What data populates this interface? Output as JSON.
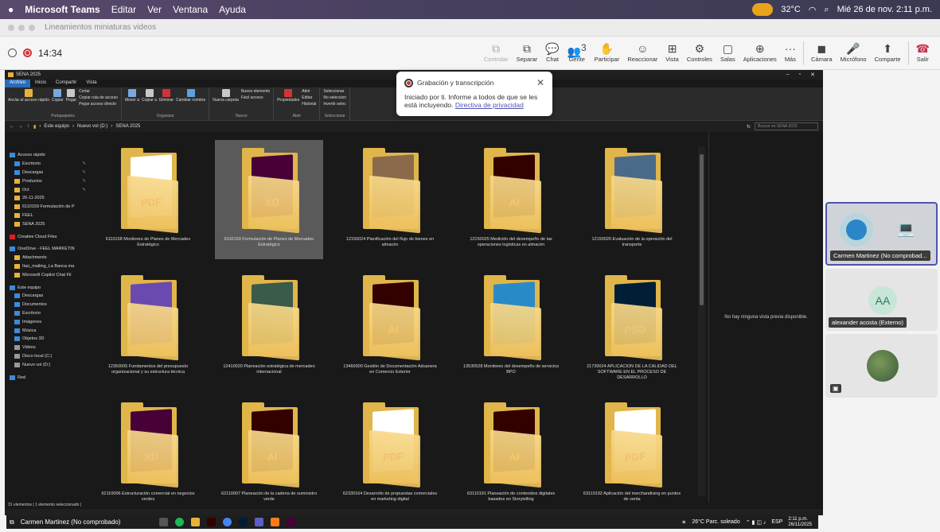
{
  "menubar": {
    "app": "Microsoft Teams",
    "menus": [
      "Editar",
      "Ver",
      "Ventana",
      "Ayuda"
    ],
    "weather": "32°C",
    "datetime": "Mié 26 de nov.  2:11 p.m."
  },
  "window": {
    "title": "Lineamientos miniaturas videos"
  },
  "meeting": {
    "timer": "14:34",
    "buttons": [
      {
        "label": "Controlar",
        "icon": "control-icon",
        "glyph": "⧉",
        "disabled": true
      },
      {
        "label": "Separar",
        "icon": "popout-icon",
        "glyph": "⧉"
      },
      {
        "label": "Chat",
        "icon": "chat-icon",
        "glyph": "💬"
      },
      {
        "label": "Gente",
        "icon": "people-icon",
        "glyph": "👥",
        "count": "3"
      },
      {
        "label": "Participar",
        "icon": "raise-hand-icon",
        "glyph": "✋"
      },
      {
        "label": "Reaccionar",
        "icon": "react-icon",
        "glyph": "☺"
      },
      {
        "label": "Vista",
        "icon": "view-icon",
        "glyph": "⊞"
      },
      {
        "label": "Controles",
        "icon": "controls-icon",
        "glyph": "⚙"
      },
      {
        "label": "Salas",
        "icon": "rooms-icon",
        "glyph": "▢"
      },
      {
        "label": "Aplicaciones",
        "icon": "apps-icon",
        "glyph": "⊕"
      },
      {
        "label": "Más",
        "icon": "more-icon",
        "glyph": "···"
      }
    ],
    "media": [
      {
        "label": "Cámara",
        "icon": "camera-off-icon",
        "glyph": "◼"
      },
      {
        "label": "Micrófono",
        "icon": "mic-icon",
        "glyph": "🎤"
      },
      {
        "label": "Comparte",
        "icon": "share-icon",
        "glyph": "⬆"
      }
    ],
    "leave": {
      "label": "Salir",
      "icon": "leave-icon",
      "glyph": "☎"
    }
  },
  "popup": {
    "title": "Grabación y transcripción",
    "body": "Iniciado por ti. Informe a todos de que se les está incluyendo.",
    "link": "Directiva de privacidad"
  },
  "explorer": {
    "title": "SENA 2025",
    "tabs": [
      "Archivo",
      "Inicio",
      "Compartir",
      "Vista"
    ],
    "ribbon": [
      {
        "group": "Portapapeles",
        "items": [
          "Anclar al acceso rápido",
          "Copiar",
          "Pegar"
        ],
        "list": [
          "Cortar",
          "Copiar ruta de acceso",
          "Pegar acceso directo"
        ]
      },
      {
        "group": "Organizar",
        "items": [
          "Mover a",
          "Copiar a",
          "Eliminar",
          "Cambiar nombre"
        ],
        "list": []
      },
      {
        "group": "Nuevo",
        "items": [
          "Nueva carpeta"
        ],
        "list": [
          "Nuevo elemento",
          "Fácil acceso"
        ]
      },
      {
        "group": "Abrir",
        "items": [
          "Propiedades"
        ],
        "list": [
          "Abrir",
          "Editar",
          "Historial"
        ]
      },
      {
        "group": "Seleccionar",
        "items": [],
        "list": [
          "Seleccionar",
          "No seleccion",
          "Invertir selec"
        ]
      }
    ],
    "path": [
      "Este equipo",
      "Nuevo vol (D:)",
      "SENA 2025"
    ],
    "search_placeholder": "Buscar en SENA 2025",
    "nav": [
      {
        "label": "Acceso rápido",
        "kind": "star",
        "indent": 0
      },
      {
        "label": "Escritorio",
        "kind": "blue",
        "indent": 1,
        "pin": true
      },
      {
        "label": "Descargas",
        "kind": "down",
        "indent": 1,
        "pin": true
      },
      {
        "label": "Productos",
        "kind": "folder",
        "indent": 1,
        "pin": true
      },
      {
        "label": "Oct",
        "kind": "folder",
        "indent": 1,
        "pin": true
      },
      {
        "label": "26-11-2025",
        "kind": "folder",
        "indent": 1
      },
      {
        "label": "6110159 Formulación de P",
        "kind": "folder",
        "indent": 1
      },
      {
        "label": "FEEL",
        "kind": "folder",
        "indent": 1
      },
      {
        "label": "SENA 2025",
        "kind": "folder",
        "indent": 1
      },
      {
        "label": "",
        "kind": "gap",
        "indent": 0
      },
      {
        "label": "Creative Cloud Files",
        "kind": "cc",
        "indent": 0
      },
      {
        "label": "",
        "kind": "gap",
        "indent": 0
      },
      {
        "label": "OneDrive - FEEL MARKETIN",
        "kind": "cloud",
        "indent": 0
      },
      {
        "label": "Attachments",
        "kind": "folder",
        "indent": 1
      },
      {
        "label": "Itaú_mailing_La Banca ma",
        "kind": "folder",
        "indent": 1
      },
      {
        "label": "Microsoft Copilot Chat Fil",
        "kind": "folder",
        "indent": 1
      },
      {
        "label": "",
        "kind": "gap",
        "indent": 0
      },
      {
        "label": "Este equipo",
        "kind": "pc",
        "indent": 0
      },
      {
        "label": "Descargas",
        "kind": "down",
        "indent": 1
      },
      {
        "label": "Documentos",
        "kind": "blue",
        "indent": 1
      },
      {
        "label": "Escritorio",
        "kind": "blue",
        "indent": 1
      },
      {
        "label": "Imágenes",
        "kind": "blue",
        "indent": 1
      },
      {
        "label": "Música",
        "kind": "music",
        "indent": 1
      },
      {
        "label": "Objetos 3D",
        "kind": "blue",
        "indent": 1
      },
      {
        "label": "Videos",
        "kind": "gray",
        "indent": 1
      },
      {
        "label": "Disco local (C:)",
        "kind": "gray",
        "indent": 1
      },
      {
        "label": "Nuevo vol (D:)",
        "kind": "gray",
        "indent": 1
      },
      {
        "label": "",
        "kind": "gap",
        "indent": 0
      },
      {
        "label": "Red",
        "kind": "blue",
        "indent": 0
      }
    ],
    "folders": [
      {
        "name": "6110158 Monitoreo de Planes de Mercadeo Estratégico",
        "doc": "PDF",
        "color": "#ffffff",
        "fg": "#d32f2f"
      },
      {
        "name": "6110159 Formulación de Planes de Mercadeo Estratégico",
        "doc": "XD",
        "color": "#470137",
        "fg": "#ff61f6",
        "selected": true
      },
      {
        "name": "12150024 Planificación del flujo de bienes en almacén",
        "doc": "",
        "color": "#8a6a4a",
        "fg": "#ffffff"
      },
      {
        "name": "12150025 Medición del desempeño de las operaciones logísticas en almacén",
        "doc": "AI",
        "color": "#330000",
        "fg": "#ff9a00"
      },
      {
        "name": "12150026 Evaluación de la operación del transporte",
        "doc": "",
        "color": "#4a6a8a",
        "fg": "#ffffff"
      },
      {
        "name": "12350005 Fundamentos del presupuesto organizacional y su estructura técnica",
        "doc": "",
        "color": "#6a4ab0",
        "fg": "#ffffff"
      },
      {
        "name": "12410020 Planeación estratégica de mercadeo internacional",
        "doc": "",
        "color": "#3a5a4a",
        "fg": "#ffffff"
      },
      {
        "name": "13460000 Gestión de Documentación Aduanera en Comercio Exterior",
        "doc": "AI",
        "color": "#330000",
        "fg": "#ff9a00"
      },
      {
        "name": "13530528 Monitoreo del desempeño de servicios BPO",
        "doc": "",
        "color": "#2a8ac8",
        "fg": "#ffffff"
      },
      {
        "name": "21730024 APLICACION DE LA CALIDAD DEL SOFTWARE EN EL PROCESO DE DESARROLLO",
        "doc": "PSD",
        "color": "#001e36",
        "fg": "#31a8ff"
      },
      {
        "name": "62110006 Estructuración comercial en negocios verdes",
        "doc": "XD",
        "color": "#470137",
        "fg": "#ff61f6"
      },
      {
        "name": "62110007 Planeación de la cadena de suministro verde",
        "doc": "AI",
        "color": "#330000",
        "fg": "#ff9a00"
      },
      {
        "name": "62330164 Desarrollo de propuestas comerciales en marketing digital",
        "doc": "PDF",
        "color": "#ffffff",
        "fg": "#d32f2f"
      },
      {
        "name": "63110191 Planeación de contenidos digitales basados en Storytelling",
        "doc": "AI",
        "color": "#330000",
        "fg": "#ff9a00"
      },
      {
        "name": "63110192 Aplicación del merchandising en puntos de venta",
        "doc": "PDF",
        "color": "#ffffff",
        "fg": "#d32f2f"
      }
    ],
    "preview_text": "No hay ninguna vista previa disponible.",
    "status": "31 elementos  |  1 elemento seleccionado  |"
  },
  "share_bar": {
    "presenter": "Carmen Martinez (No comprobado)",
    "weather": "26°C  Parc. soleado",
    "lang": "ESP",
    "time": "2:11 p.m.",
    "date": "26/11/2025"
  },
  "participants": [
    {
      "name": "Carmen Martinez (No comprobad...",
      "initials": "",
      "active": true
    },
    {
      "name": "alexander acosta (Externo)",
      "initials": "AA"
    },
    {
      "name": "",
      "initials": ""
    }
  ],
  "colors": {
    "teams_accent": "#4f52b2",
    "leave_red": "#c4314b",
    "folder": "#e0b54a",
    "rec_red": "#d13438"
  }
}
